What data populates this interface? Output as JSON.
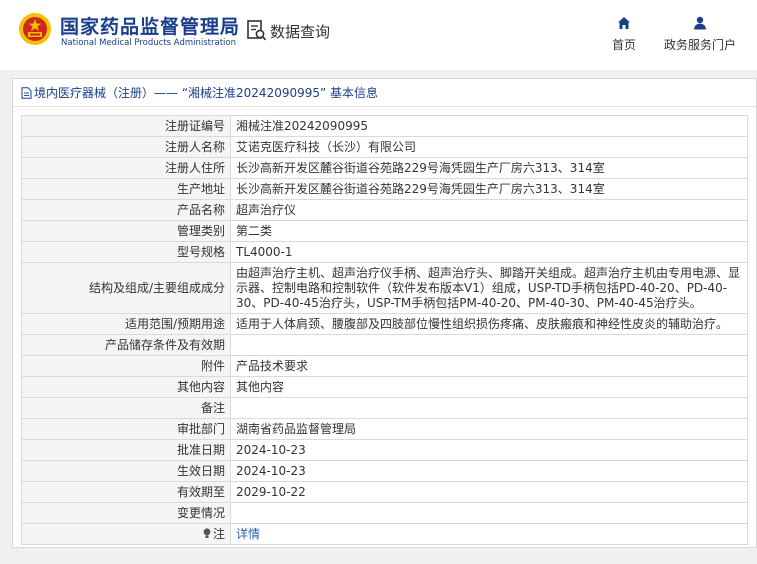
{
  "header": {
    "site_name": "国家药品监督管理局",
    "site_name_en": "National Medical Products Administration",
    "query_label": "数据查询",
    "nav": {
      "home": "首页",
      "portal": "政务服务门户"
    }
  },
  "panel": {
    "title": "境内医疗器械（注册）—— “湘械注准20242090995” 基本信息"
  },
  "rows": [
    {
      "label": "注册证编号",
      "value": "湘械注准20242090995"
    },
    {
      "label": "注册人名称",
      "value": "艾诺克医疗科技（长沙）有限公司"
    },
    {
      "label": "注册人住所",
      "value": "长沙高新开发区麓谷街道谷苑路229号海凭园生产厂房六313、314室"
    },
    {
      "label": "生产地址",
      "value": "长沙高新开发区麓谷街道谷苑路229号海凭园生产厂房六313、314室"
    },
    {
      "label": "产品名称",
      "value": "超声治疗仪"
    },
    {
      "label": "管理类别",
      "value": "第二类"
    },
    {
      "label": "型号规格",
      "value": "TL4000-1"
    },
    {
      "label": "结构及组成/主要组成成分",
      "value": "由超声治疗主机、超声治疗仪手柄、超声治疗头、脚踏开关组成。超声治疗主机由专用电源、显示器、控制电路和控制软件（软件发布版本V1）组成，USP-TD手柄包括PD-40-20、PD-40-30、PD-40-45治疗头，USP-TM手柄包括PM-40-20、PM-40-30、PM-40-45治疗头。"
    },
    {
      "label": "适用范围/预期用途",
      "value": "适用于人体肩颈、腰腹部及四肢部位慢性组织损伤疼痛、皮肤瘢痕和神经性皮炎的辅助治疗。"
    },
    {
      "label": "产品储存条件及有效期",
      "value": ""
    },
    {
      "label": "附件",
      "value": "产品技术要求"
    },
    {
      "label": "其他内容",
      "value": "其他内容"
    },
    {
      "label": "备注",
      "value": ""
    },
    {
      "label": "审批部门",
      "value": "湖南省药品监督管理局"
    },
    {
      "label": "批准日期",
      "value": "2024-10-23"
    },
    {
      "label": "生效日期",
      "value": "2024-10-23"
    },
    {
      "label": "有效期至",
      "value": "2029-10-22"
    },
    {
      "label": "变更情况",
      "value": ""
    }
  ],
  "note_row": {
    "label": "注",
    "link": "详情"
  },
  "colors": {
    "brand_blue": "#1a3e8c",
    "link_blue": "#2a5fb0",
    "label_bg": "#f5f5f5"
  },
  "icons": {
    "emblem": "national-emblem-icon",
    "query": "document-search-icon",
    "home": "home-icon",
    "portal": "user-icon",
    "doc": "document-icon",
    "note": "lightbulb-icon"
  }
}
